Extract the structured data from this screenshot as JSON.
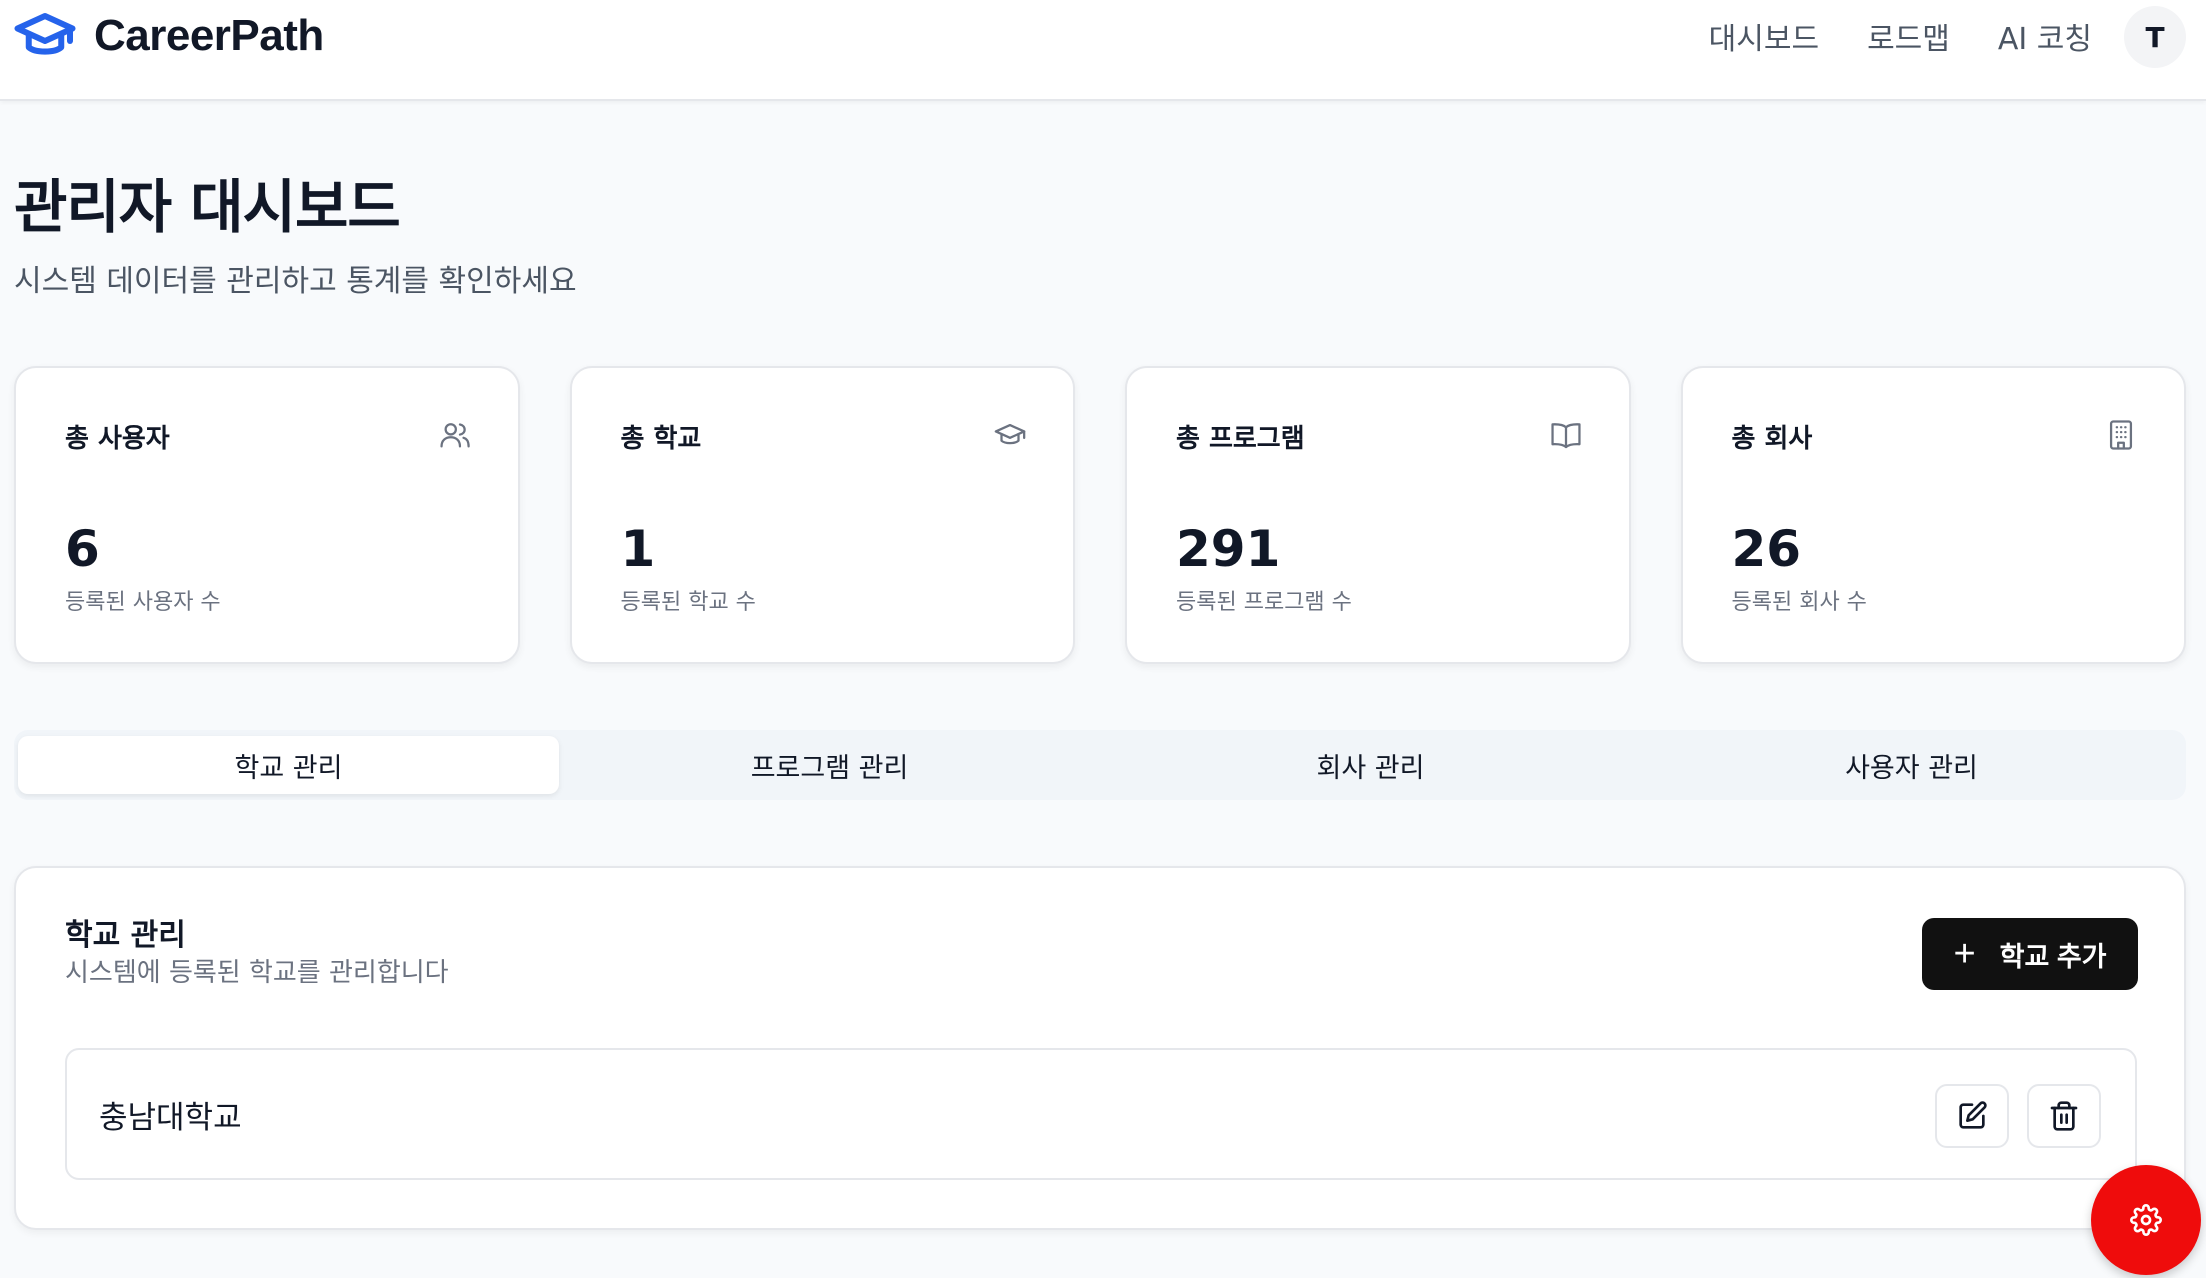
{
  "header": {
    "logo_text": "CareerPath",
    "logo_icon": "graduation-cap-icon",
    "nav": [
      "대시보드",
      "로드맵",
      "AI 코칭"
    ],
    "avatar_initial": "T"
  },
  "page": {
    "title": "관리자 대시보드",
    "subtitle": "시스템 데이터를 관리하고 통계를 확인하세요"
  },
  "stats": [
    {
      "label": "총 사용자",
      "value": "6",
      "desc": "등록된 사용자 수",
      "icon": "users-icon"
    },
    {
      "label": "총 학교",
      "value": "1",
      "desc": "등록된 학교 수",
      "icon": "graduation-cap-icon"
    },
    {
      "label": "총 프로그램",
      "value": "291",
      "desc": "등록된 프로그램 수",
      "icon": "book-icon"
    },
    {
      "label": "총 회사",
      "value": "26",
      "desc": "등록된 회사 수",
      "icon": "building-icon"
    }
  ],
  "tabs": {
    "items": [
      "학교 관리",
      "프로그램 관리",
      "회사 관리",
      "사용자 관리"
    ],
    "active": "학교 관리"
  },
  "panel": {
    "title": "학교 관리",
    "subtitle": "시스템에 등록된 학교를 관리합니다",
    "add_button": "학교 추가",
    "schools": [
      {
        "name": "충남대학교"
      }
    ]
  },
  "colors": {
    "accent_blue": "#2563eb",
    "primary_button": "#111111",
    "fab_red": "#ef0c0c"
  }
}
